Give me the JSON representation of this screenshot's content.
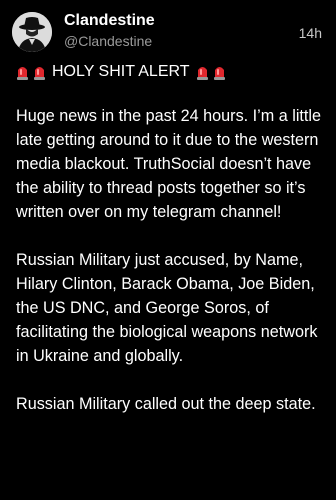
{
  "account": {
    "display_name": "Clandestine",
    "handle": "@Clandestine",
    "avatar_icon": "spy-silhouette-icon"
  },
  "post": {
    "timestamp": "14h",
    "alert_icon": "police-siren-emoji",
    "alert_text": "HOLY SHIT ALERT",
    "paragraphs": [
      "Huge news in the past 24 hours. I’m a little late getting around to it due to the western media blackout. TruthSocial doesn’t have the ability to thread posts together so it’s written over on my telegram channel!",
      "Russian Military just accused, by Name, Hilary Clinton, Barack Obama, Joe Biden, the US DNC, and George Soros, of facilitating the biological weapons network in Ukraine and globally.",
      "Russian Military called out the deep state."
    ]
  },
  "colors": {
    "background": "#000000",
    "text": "#ffffff",
    "handle": "#9a9a9a",
    "siren_red": "#e0282e"
  }
}
